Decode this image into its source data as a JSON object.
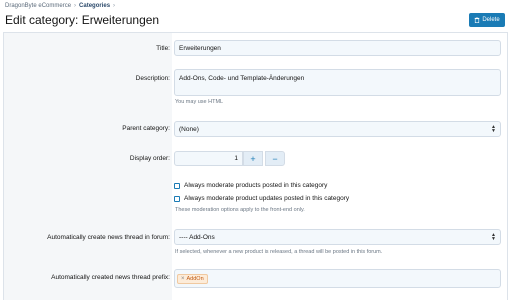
{
  "breadcrumb": {
    "items": [
      "DragonByte eCommerce",
      "Categories"
    ]
  },
  "header": {
    "title": "Edit category: Erweiterungen",
    "delete_label": "Delete"
  },
  "form": {
    "title": {
      "label": "Title:",
      "value": "Erweiterungen"
    },
    "description": {
      "label": "Description:",
      "value": "Add-Ons, Code- und Template-Änderungen",
      "hint": "You may use HTML"
    },
    "parent_category": {
      "label": "Parent category:",
      "value": "(None)"
    },
    "display_order": {
      "label": "Display order:",
      "value": "1",
      "plus": "+",
      "minus": "−"
    },
    "moderation": {
      "options": [
        {
          "label": "Always moderate products posted in this category",
          "checked": false
        },
        {
          "label": "Always moderate product updates posted in this category",
          "checked": false
        }
      ],
      "hint": "These moderation options apply to the front-end only."
    },
    "news_thread_forum": {
      "label": "Automatically create news thread in forum:",
      "value": "---- Add-Ons",
      "hint": "If selected, whenever a new product is released, a thread will be posted in this forum."
    },
    "news_thread_prefix": {
      "label": "Automatically created news thread prefix:",
      "tag": "AddOn",
      "tag_remove": "×"
    }
  },
  "colors": {
    "accent": "#1a7bb5",
    "label_bg": "#f5f7f9",
    "input_bg": "#f3f8fc",
    "tag_bg": "#fdecd9",
    "tag_text": "#c05a12"
  }
}
